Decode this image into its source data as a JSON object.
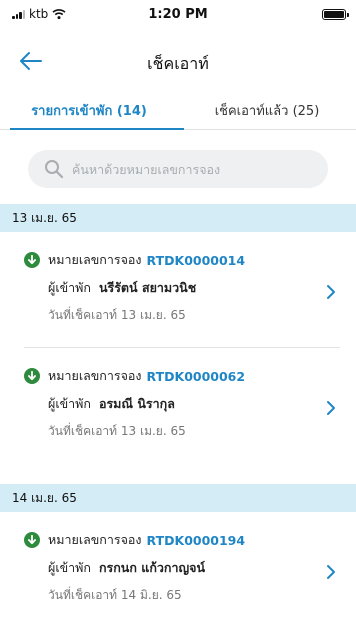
{
  "status_bar": {
    "carrier": "ktb",
    "time": "1:20 PM"
  },
  "nav": {
    "title": "เช็คเอาท์"
  },
  "tabs": [
    {
      "label": "รายการเข้าพัก (14)",
      "active": true
    },
    {
      "label": "เช็คเอาท์แล้ว (25)",
      "active": false
    }
  ],
  "search": {
    "placeholder": "ค้นหาด้วยหมายเลขการจอง",
    "value": ""
  },
  "groups": [
    {
      "date": "13 เม.ย. 65",
      "bookings": [
        {
          "booking_label": "หมายเลขการจอง",
          "booking_number": "RTDK0000014",
          "guest_label": "ผู้เข้าพัก",
          "guest_name": "นรีรัตน์ สยามวนิช",
          "checkout_text": "วันที่เช็คเอาท์ 13 เม.ย. 65"
        },
        {
          "booking_label": "หมายเลขการจอง",
          "booking_number": "RTDK0000062",
          "guest_label": "ผู้เข้าพัก",
          "guest_name": "อรมณี นิรากุล",
          "checkout_text": "วันที่เช็คเอาท์ 13 เม.ย. 65"
        }
      ]
    },
    {
      "date": "14 เม.ย. 65",
      "bookings": [
        {
          "booking_label": "หมายเลขการจอง",
          "booking_number": "RTDK0000194",
          "guest_label": "ผู้เข้าพัก",
          "guest_name": "กรกนก แก้วกาญจน์",
          "checkout_text": "วันที่เช็คเอาท์ 14 มิ.ย. 65"
        }
      ]
    }
  ],
  "colors": {
    "accent": "#1f86c6",
    "header_bg": "#d4ecf6",
    "icon_green": "#2e8b3e"
  }
}
